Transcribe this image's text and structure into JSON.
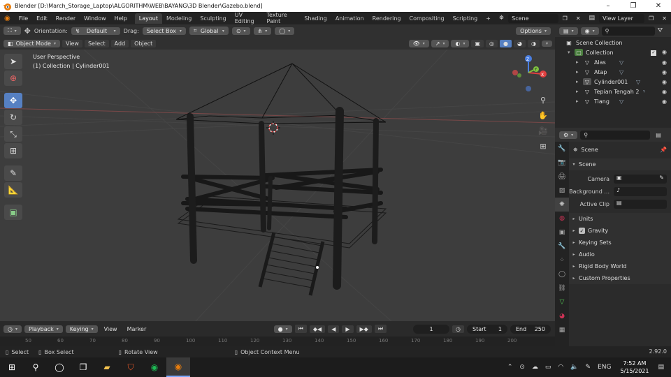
{
  "window": {
    "title": "Blender [D:\\March_Storage_Laptop\\ALGORITHM\\WEB\\BAYANG\\3D Blender\\Gazebo.blend]",
    "minimize": "–",
    "maximize": "❐",
    "close": "✕"
  },
  "menus": [
    "File",
    "Edit",
    "Render",
    "Window",
    "Help"
  ],
  "workspaces": [
    "Layout",
    "Modeling",
    "Sculpting",
    "UV Editing",
    "Texture Paint",
    "Shading",
    "Animation",
    "Rendering",
    "Compositing",
    "Scripting"
  ],
  "workspace_add": "+",
  "scene_name": "Scene",
  "view_layer": "View Layer",
  "toolheader": {
    "orientation_label": "Orientation:",
    "orientation_value": "Default",
    "drag_label": "Drag:",
    "drag_value": "Select Box",
    "transform_value": "Global",
    "options": "Options"
  },
  "vpheader": {
    "mode": "Object Mode",
    "items": [
      "View",
      "Select",
      "Add",
      "Object"
    ]
  },
  "viewport": {
    "perspective": "User Perspective",
    "collection_info": "(1) Collection | Cylinder001"
  },
  "gizmo": {
    "x": "X",
    "y": "Y",
    "z": "Z"
  },
  "outliner": {
    "scene_collection": "Scene Collection",
    "collection": "Collection",
    "items": [
      "Alas",
      "Atap",
      "Cylinder001",
      "Tepian Tengah 2",
      "Tiang"
    ]
  },
  "properties": {
    "search_placeholder": "",
    "scene_title": "Scene",
    "scene_panel": "Scene",
    "camera_label": "Camera",
    "background_label": "Background ...",
    "active_clip_label": "Active Clip",
    "panels": [
      "Units",
      "Gravity",
      "Keying Sets",
      "Audio",
      "Rigid Body World",
      "Custom Properties"
    ]
  },
  "timeline": {
    "playback": "Playback",
    "keying": "Keying",
    "view": "View",
    "marker": "Marker",
    "current_frame": "1",
    "start_label": "Start",
    "start_value": "1",
    "end_label": "End",
    "end_value": "250",
    "ruler": [
      "50",
      "60",
      "70",
      "80",
      "90",
      "100",
      "110",
      "120",
      "130",
      "140",
      "150",
      "160",
      "170",
      "180",
      "190",
      "200"
    ]
  },
  "statusbar": {
    "select": "Select",
    "box_select": "Box Select",
    "rotate_view": "Rotate View",
    "context_menu": "Object Context Menu",
    "version": "2.92.0"
  },
  "taskbar": {
    "language": "ENG",
    "time": "7:52 AM",
    "date": "5/15/2021"
  },
  "colors": {
    "accent": "#5680c2",
    "selection": "#334d80",
    "axis_x": "#e04040",
    "axis_y": "#7ec040",
    "axis_z": "#4a7ee0"
  }
}
